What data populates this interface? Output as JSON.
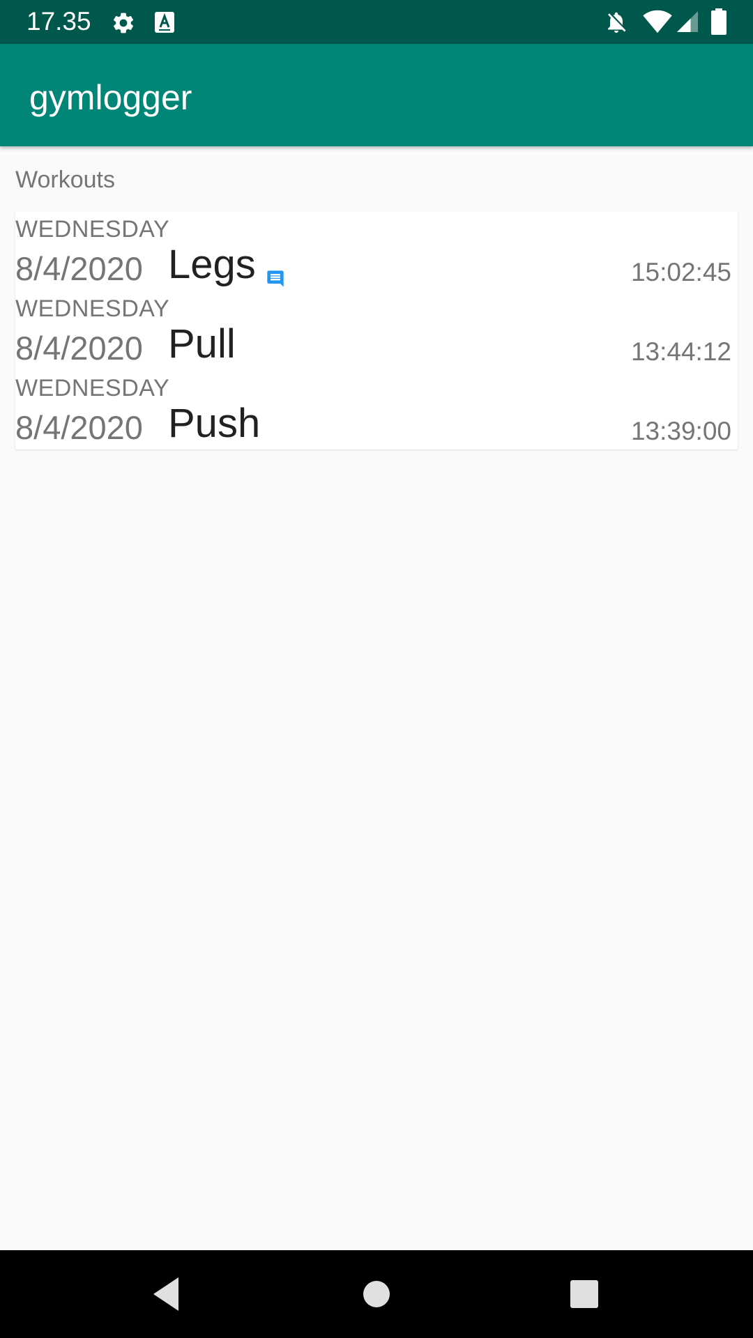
{
  "status_bar": {
    "time": "17.35",
    "icons": [
      "gear-icon",
      "a-keyboard-icon",
      "notifications-off-icon",
      "wifi-icon",
      "signal-icon",
      "battery-icon"
    ]
  },
  "app_bar": {
    "title": "gymlogger",
    "background": "#008577",
    "status_background": "#00574b"
  },
  "content": {
    "section_label": "Workouts",
    "workouts": [
      {
        "day": "WEDNESDAY",
        "date": "8/4/2020",
        "name": "Legs",
        "time": "15:02:45",
        "has_note": true
      },
      {
        "day": "WEDNESDAY",
        "date": "8/4/2020",
        "name": "Pull",
        "time": "13:44:12",
        "has_note": false
      },
      {
        "day": "WEDNESDAY",
        "date": "8/4/2020",
        "name": "Push",
        "time": "13:39:00",
        "has_note": false
      }
    ],
    "note_icon_color": "#2196f3"
  },
  "nav_bar": {
    "buttons": [
      "back-icon",
      "home-icon",
      "recents-icon"
    ]
  }
}
